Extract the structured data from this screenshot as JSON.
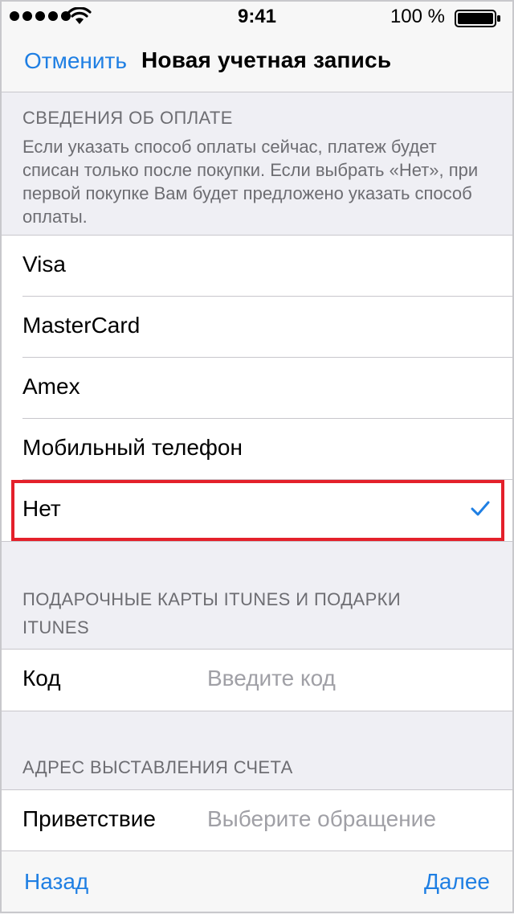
{
  "status_bar": {
    "time": "9:41",
    "battery_percent": "100 %",
    "icons": [
      "signal-dots-icon",
      "wifi-icon",
      "battery-icon"
    ]
  },
  "nav": {
    "cancel_label": "Отменить",
    "title": "Новая учетная запись"
  },
  "payment": {
    "header": "СВЕДЕНИЯ ОБ ОПЛАТЕ",
    "description": "Если указать способ оплаты сейчас, платеж будет списан только после покупки. Если выбрать «Нет», при первой покупке Вам будет предложено указать способ оплаты.",
    "options": [
      "Visa",
      "MasterCard",
      "Amex",
      "Мобильный телефон",
      "Нет"
    ],
    "selected": "Нет"
  },
  "gift_cards": {
    "header": "ПОДАРОЧНЫЕ КАРТЫ ITUNES И ПОДАРКИ ITUNES",
    "code_label": "Код",
    "code_placeholder": "Введите код"
  },
  "billing": {
    "header": "АДРЕС ВЫСТАВЛЕНИЯ СЧЕТА",
    "salutation_label": "Приветствие",
    "salutation_placeholder": "Выберите обращение"
  },
  "toolbar": {
    "back_label": "Назад",
    "next_label": "Далее"
  },
  "colors": {
    "accent": "#1f7fe3",
    "highlight": "#e4202b",
    "background": "#efeff4"
  }
}
